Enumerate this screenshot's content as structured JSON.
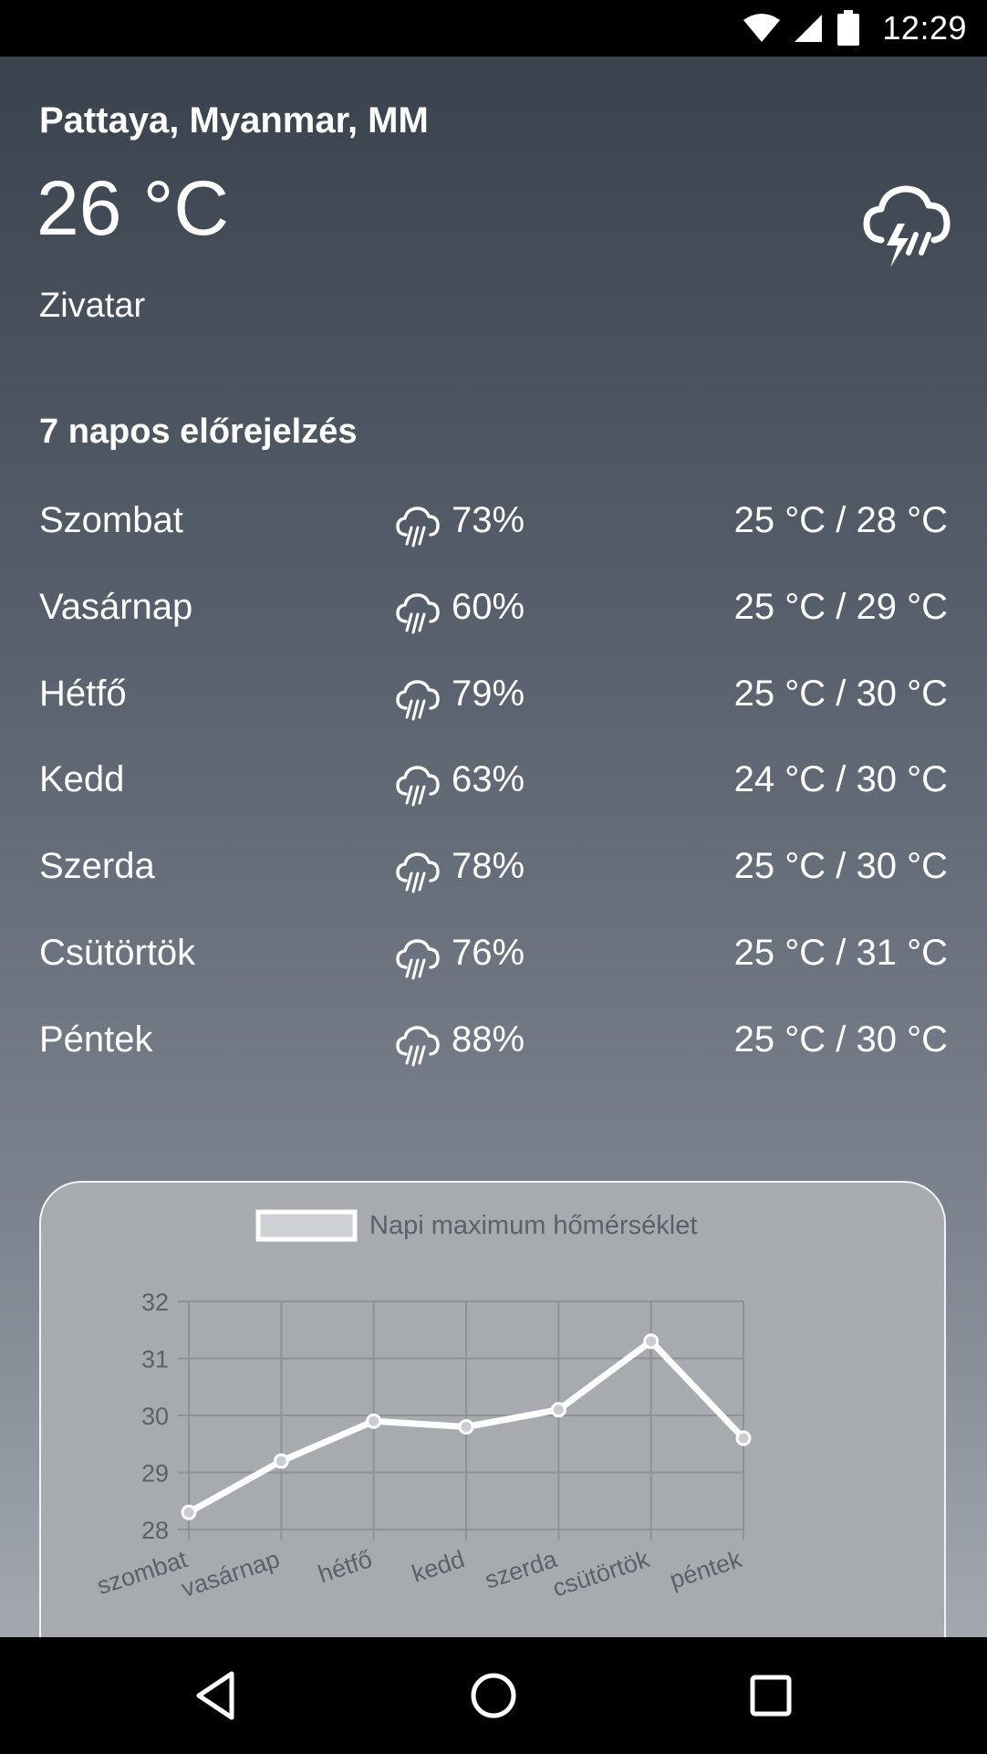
{
  "status_bar": {
    "time": "12:29",
    "icons": [
      "wifi-icon",
      "cell-signal-icon",
      "battery-icon"
    ]
  },
  "current": {
    "location": "Pattaya, Myanmar, MM",
    "temperature": "26 °C",
    "condition": "Zivatar",
    "icon": "thunderstorm-icon"
  },
  "forecast": {
    "title": "7 napos előrejelzés",
    "days": [
      {
        "day": "Szombat",
        "precip": "73%",
        "range": "25 °C / 28 °C",
        "icon": "rain-icon"
      },
      {
        "day": "Vasárnap",
        "precip": "60%",
        "range": "25 °C / 29 °C",
        "icon": "rain-icon"
      },
      {
        "day": "Hétfő",
        "precip": "79%",
        "range": "25 °C / 30 °C",
        "icon": "rain-icon"
      },
      {
        "day": "Kedd",
        "precip": "63%",
        "range": "24 °C / 30 °C",
        "icon": "rain-icon"
      },
      {
        "day": "Szerda",
        "precip": "78%",
        "range": "25 °C / 30 °C",
        "icon": "rain-icon"
      },
      {
        "day": "Csütörtök",
        "precip": "76%",
        "range": "25 °C / 31 °C",
        "icon": "rain-icon"
      },
      {
        "day": "Péntek",
        "precip": "88%",
        "range": "25 °C / 30 °C",
        "icon": "rain-icon"
      }
    ]
  },
  "chart_data": {
    "type": "line",
    "categories": [
      "szombat",
      "vasárnap",
      "hétfő",
      "kedd",
      "szerda",
      "csütörtök",
      "péntek"
    ],
    "series": [
      {
        "name": "Napi maximum hőmérséklet",
        "values": [
          28.3,
          29.2,
          29.9,
          29.8,
          30.1,
          31.3,
          29.6
        ]
      }
    ],
    "yticks": [
      28,
      29,
      30,
      31,
      32
    ],
    "ylim": [
      28,
      32
    ],
    "grid": true,
    "legend": "top",
    "line_color": "#ffffff",
    "grid_color": "#8e9298"
  },
  "nav_bar": {
    "buttons": [
      "back-icon",
      "home-icon",
      "recents-icon"
    ]
  }
}
